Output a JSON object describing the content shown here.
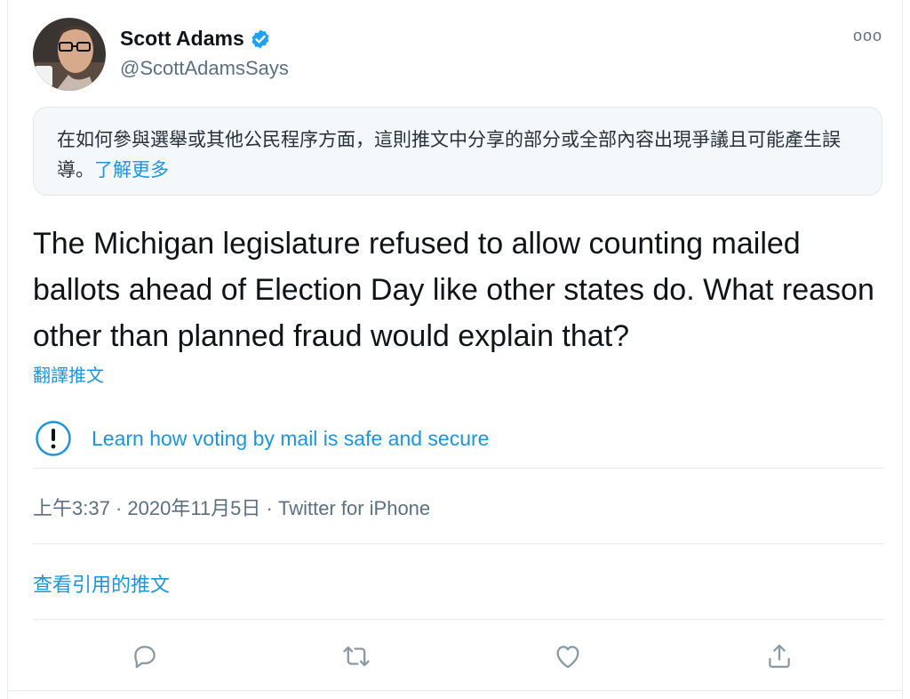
{
  "author": {
    "name": "Scott Adams",
    "handle": "@ScottAdamsSays",
    "verified": true
  },
  "more_icon": "ooo",
  "notice": {
    "text": "在如何參與選舉或其他公民程序方面，這則推文中分享的部分或全部內容出現爭議且可能產生誤導。",
    "link_label": "了解更多"
  },
  "tweet": {
    "text": "The Michigan legislature refused to allow counting mailed ballots ahead of Election Day like other states do. What reason other than planned fraud would explain that?",
    "translate_label": "翻譯推文"
  },
  "learn_more": {
    "icon": "exclamation-circle-icon",
    "label": "Learn how voting by mail is safe and secure"
  },
  "meta": {
    "time": "上午3:37",
    "date": "2020年11月5日",
    "source": "Twitter for iPhone",
    "separator": " · "
  },
  "quotes_label": "查看引用的推文",
  "actions": [
    {
      "name": "reply",
      "icon": "reply-icon"
    },
    {
      "name": "retweet",
      "icon": "retweet-icon"
    },
    {
      "name": "like",
      "icon": "heart-icon"
    },
    {
      "name": "share",
      "icon": "share-icon"
    }
  ],
  "colors": {
    "accent": "#1b95e0",
    "secondary_text": "#5b7083",
    "verified": "#1da1f2"
  }
}
